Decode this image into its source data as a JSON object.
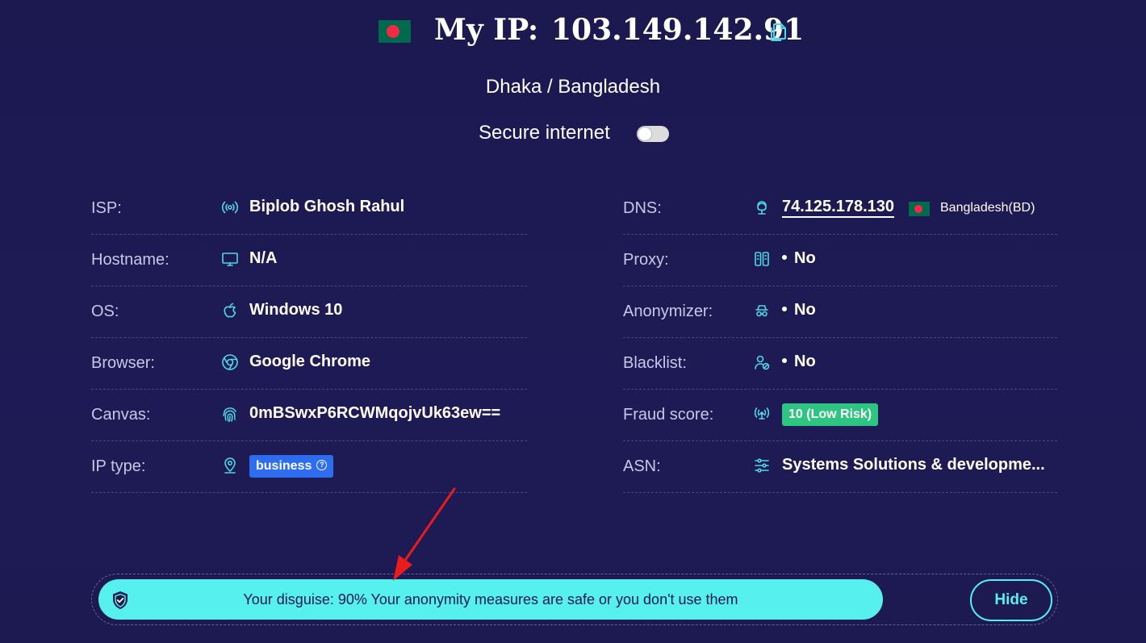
{
  "header": {
    "ip_label": "My IP:",
    "ip_value": "103.149.142.91",
    "location": "Dhaka / Bangladesh",
    "secure_internet_label": "Secure internet",
    "secure_internet_enabled": false
  },
  "left_rows": [
    {
      "label": "ISP:",
      "value": "Biplob Ghosh Rahul",
      "icon": "broadcast-icon"
    },
    {
      "label": "Hostname:",
      "value": "N/A",
      "icon": "monitor-icon"
    },
    {
      "label": "OS:",
      "value": "Windows 10",
      "icon": "apple-icon"
    },
    {
      "label": "Browser:",
      "value": "Google Chrome",
      "icon": "chrome-icon"
    },
    {
      "label": "Canvas:",
      "value": "0mBSwxP6RCWMqojvUk63ew==",
      "icon": "fingerprint-icon"
    },
    {
      "label": "IP type:",
      "value": "business",
      "icon": "location-pin-icon"
    }
  ],
  "right_rows": [
    {
      "label": "DNS:",
      "value": "74.125.178.130",
      "country": "Bangladesh(BD)",
      "icon": "dns-icon"
    },
    {
      "label": "Proxy:",
      "value": "No",
      "icon": "proxy-icon"
    },
    {
      "label": "Anonymizer:",
      "value": "No",
      "icon": "anonymizer-icon"
    },
    {
      "label": "Blacklist:",
      "value": "No",
      "icon": "blacklist-icon"
    },
    {
      "label": "Fraud score:",
      "value": "10 (Low Risk)",
      "icon": "signal-icon"
    },
    {
      "label": "ASN:",
      "value": "Systems Solutions & developme...",
      "icon": "sliders-icon"
    }
  ],
  "disguise": {
    "text": "Your disguise: 90% Your anonymity measures are safe or you don't use them",
    "hide_label": "Hide"
  },
  "colors": {
    "background": "#1d1a52",
    "accent_cyan": "#56f0ee",
    "icon_cyan": "#4fd8e6",
    "fraud_badge": "#2ec482",
    "iptype_badge": "#2f6df0",
    "annotation_arrow": "#e81c1c"
  }
}
